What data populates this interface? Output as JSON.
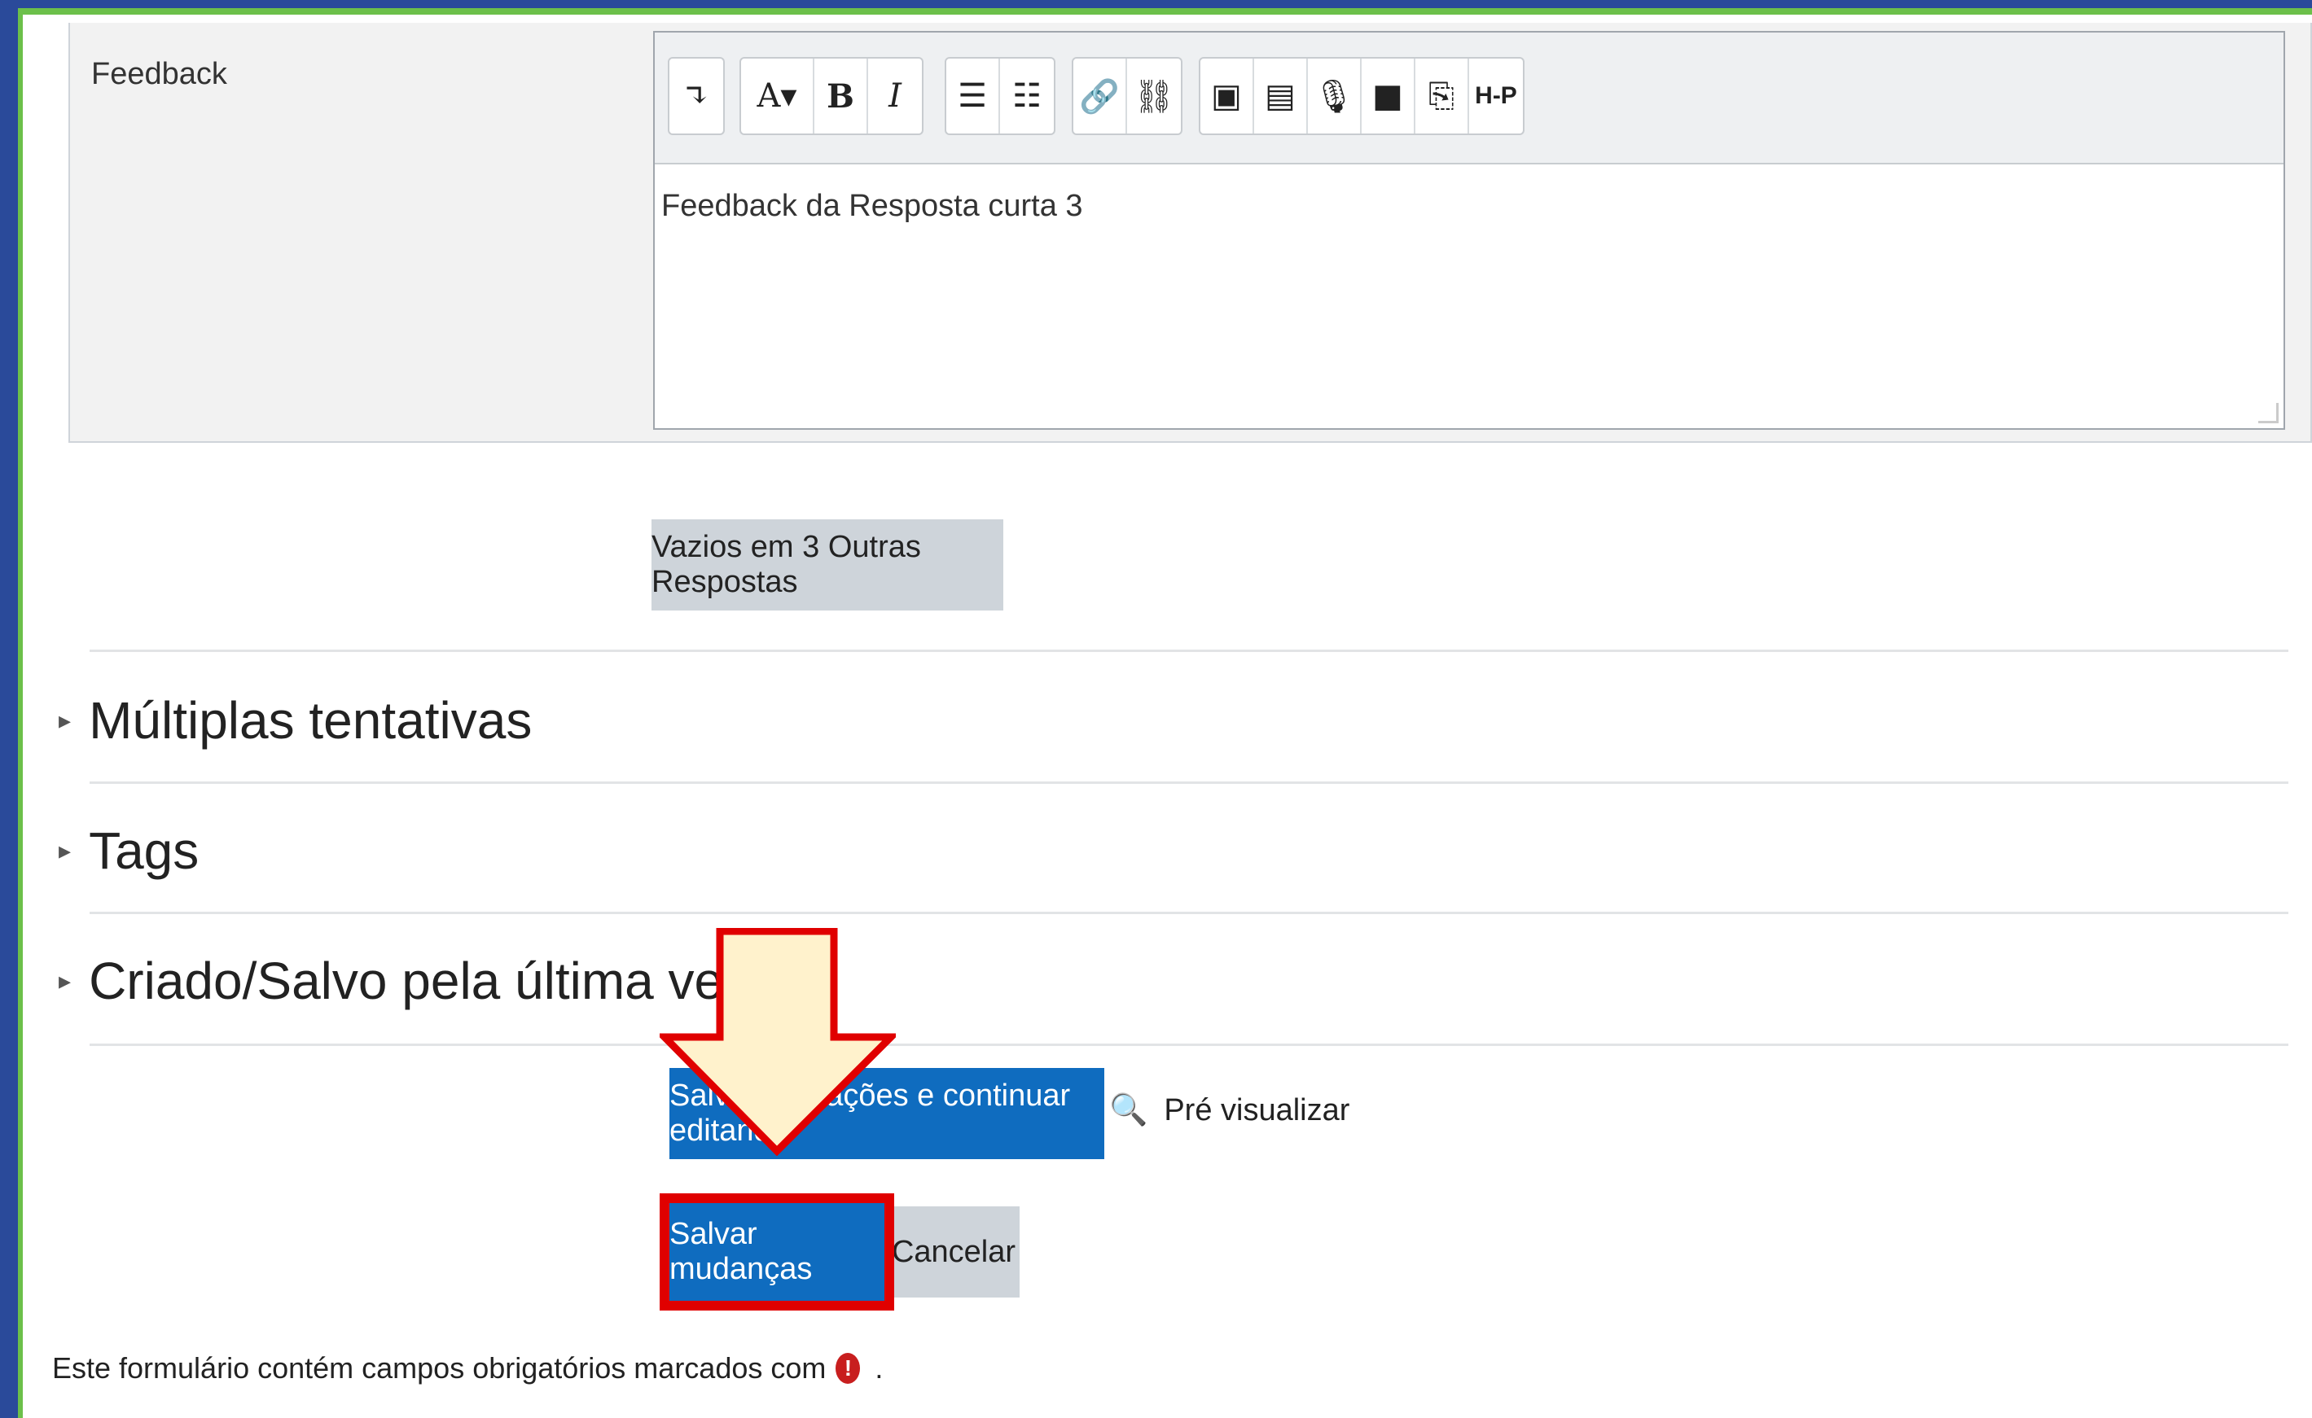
{
  "form": {
    "feedback_label": "Feedback",
    "editor_content": "Feedback da Resposta curta 3",
    "toolbar": {
      "collapse": "↴",
      "font": "A▾",
      "bold": "B",
      "italic": "I",
      "bullets": "☰",
      "numbered": "☷",
      "link": "🔗",
      "unlink": "⛓",
      "image": "▣",
      "media": "▤",
      "record_audio": "🎙",
      "record_video": "■",
      "manage_files": "⎘",
      "h5p": "H-P"
    },
    "add_blanks_button": "Vazios em 3 Outras Respostas",
    "sections": [
      {
        "title": "Múltiplas tentativas"
      },
      {
        "title": "Tags"
      },
      {
        "title": "Criado/Salvo pela última vez"
      }
    ],
    "save_continue_button": "Salvar alterações e continuar editando",
    "preview_link": "Pré visualizar",
    "save_button": "Salvar mudanças",
    "cancel_button": "Cancelar",
    "required_note": "Este formulário contém campos obrigatórios marcados com",
    "required_note_end": "."
  },
  "annotation": {
    "arrow_color": "#fff2cc",
    "arrow_border": "#e00000",
    "highlight_color": "#e00000"
  }
}
